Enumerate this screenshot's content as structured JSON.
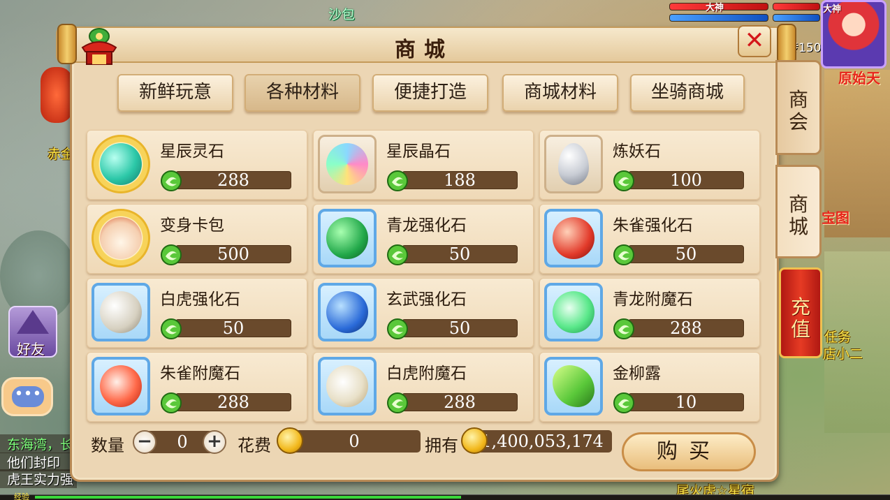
{
  "world": {
    "labels": {
      "shabao": "沙包",
      "chijin": "赤金",
      "quest": "任务",
      "inn": "店小二",
      "treasure_map": "宝图",
      "npc_partial": "原始天",
      "coords": "传150",
      "bottom_label": "尾火虎☆星宿",
      "exp": "经验",
      "friends": "好友"
    },
    "chat": [
      "东海湾，长",
      "他们封印",
      "虎王实力强"
    ]
  },
  "shop": {
    "title": "商城",
    "close_label": "✕",
    "tabs": [
      "新鲜玩意",
      "各种材料",
      "便捷打造",
      "商城材料",
      "坐骑商城"
    ],
    "active_tab_index": 1,
    "side_tabs": [
      "商会",
      "商城"
    ],
    "recharge_label": "充值",
    "items": [
      {
        "name": "星辰灵石",
        "price": "288",
        "frame": "gold",
        "icon": "star-spirit-stone-icon"
      },
      {
        "name": "星辰晶石",
        "price": "188",
        "frame": "plain",
        "icon": "star-crystal-icon"
      },
      {
        "name": "炼妖石",
        "price": "100",
        "frame": "plain",
        "icon": "demon-stone-icon"
      },
      {
        "name": "变身卡包",
        "price": "500",
        "frame": "gold",
        "icon": "card-bag-icon"
      },
      {
        "name": "青龙强化石",
        "price": "50",
        "frame": "blue",
        "icon": "azure-dragon-stone-icon"
      },
      {
        "name": "朱雀强化石",
        "price": "50",
        "frame": "blue",
        "icon": "vermilion-bird-stone-icon"
      },
      {
        "name": "白虎强化石",
        "price": "50",
        "frame": "blue",
        "icon": "white-tiger-stone-icon"
      },
      {
        "name": "玄武强化石",
        "price": "50",
        "frame": "blue",
        "icon": "black-tortoise-stone-icon"
      },
      {
        "name": "青龙附魔石",
        "price": "288",
        "frame": "blue",
        "icon": "azure-dragon-enchant-icon"
      },
      {
        "name": "朱雀附魔石",
        "price": "288",
        "frame": "blue",
        "icon": "vermilion-bird-enchant-icon"
      },
      {
        "name": "白虎附魔石",
        "price": "288",
        "frame": "blue",
        "icon": "white-tiger-enchant-icon"
      },
      {
        "name": "金柳露",
        "price": "10",
        "frame": "blue",
        "icon": "golden-willow-dew-icon"
      }
    ],
    "quantity_label": "数量",
    "quantity_value": "0",
    "cost_label": "花费",
    "cost_value": "0",
    "owned_label": "拥有",
    "owned_value": "1,400,053,174",
    "buy_label": "购买"
  },
  "hud": {
    "rank_badge": "大神"
  },
  "colors": {
    "panel_bg": "#ecd6b4",
    "price_bar": "#6a4a2c",
    "close_red": "#d4161a",
    "recharge_red": "#e63b24"
  }
}
